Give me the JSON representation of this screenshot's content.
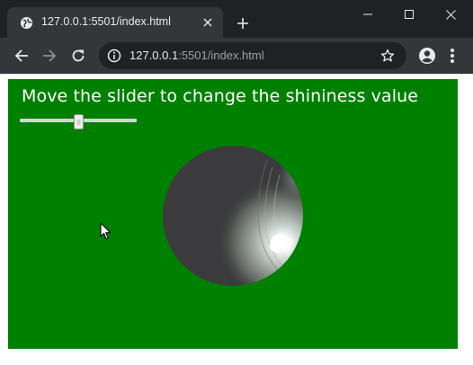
{
  "browser": {
    "tab": {
      "title": "127.0.0.1:5501/index.html",
      "favicon": "globe-icon",
      "close_icon": "close-icon"
    },
    "new_tab_icon": "plus-icon",
    "window_controls": [
      "minimize-icon",
      "maximize-icon",
      "close-icon"
    ],
    "toolbar": {
      "back_icon": "arrow-left-icon",
      "forward_icon": "arrow-right-icon",
      "reload_icon": "reload-icon",
      "site_info_icon": "info-icon",
      "url_host": "127.0.0.1",
      "url_path": ":5501/index.html",
      "bookmark_icon": "star-icon",
      "profile_icon": "account-icon",
      "menu_icon": "more-vert-icon"
    }
  },
  "page": {
    "instruction": "Move the slider to change the shininess value",
    "slider": {
      "value_fraction": 0.5
    },
    "colors": {
      "background": "#008000",
      "sphere_base": "#3b3b3d",
      "text": "#ffffff"
    }
  }
}
